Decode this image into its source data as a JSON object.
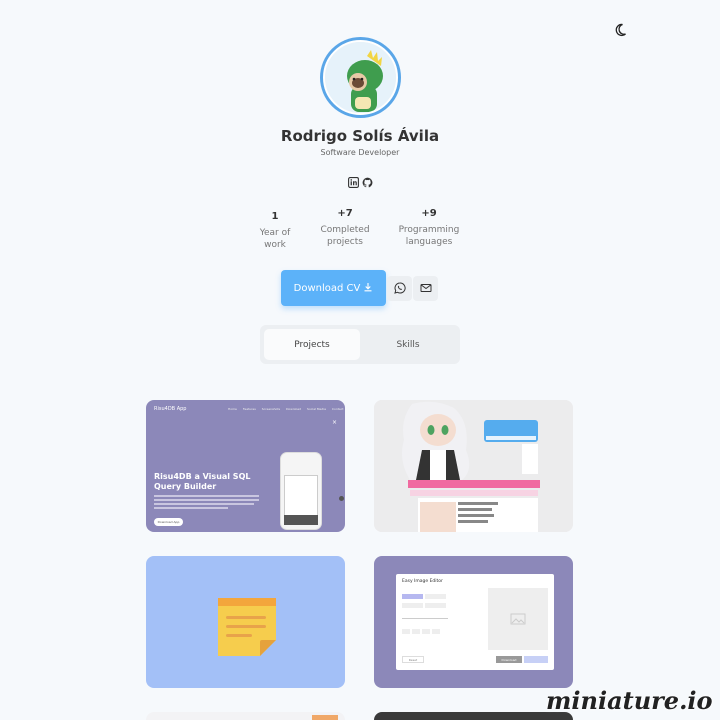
{
  "profile": {
    "name": "Rodrigo Solís Ávila",
    "role": "Software Developer"
  },
  "stats": [
    {
      "value": "1",
      "label_line1": "Year of",
      "label_line2": "work"
    },
    {
      "value": "+7",
      "label_line1": "Completed",
      "label_line2": "projects"
    },
    {
      "value": "+9",
      "label_line1": "Programming",
      "label_line2": "languages"
    }
  ],
  "actions": {
    "download_cv": "Download CV"
  },
  "tabs": [
    {
      "label": "Projects",
      "active": true
    },
    {
      "label": "Skills",
      "active": false
    }
  ],
  "projects": [
    {
      "title": "Risu4DB App",
      "nav": [
        "Home",
        "Features",
        "Screenshots",
        "Download",
        "Social Media",
        "Contact"
      ],
      "headline": "Risu4DB a Visual SQL Query Builder",
      "cta": "Download App"
    },
    {
      "logo": "twitter"
    },
    {},
    {
      "title": "Easy Image Editor",
      "primary": "Download",
      "secondary": "Reset"
    }
  ],
  "watermark": "miniature.io",
  "colors": {
    "accent": "#5cb2f9",
    "card_purple": "#8c88b9",
    "card_blue": "#a3c0f7",
    "note_yellow": "#f6cd4d"
  }
}
